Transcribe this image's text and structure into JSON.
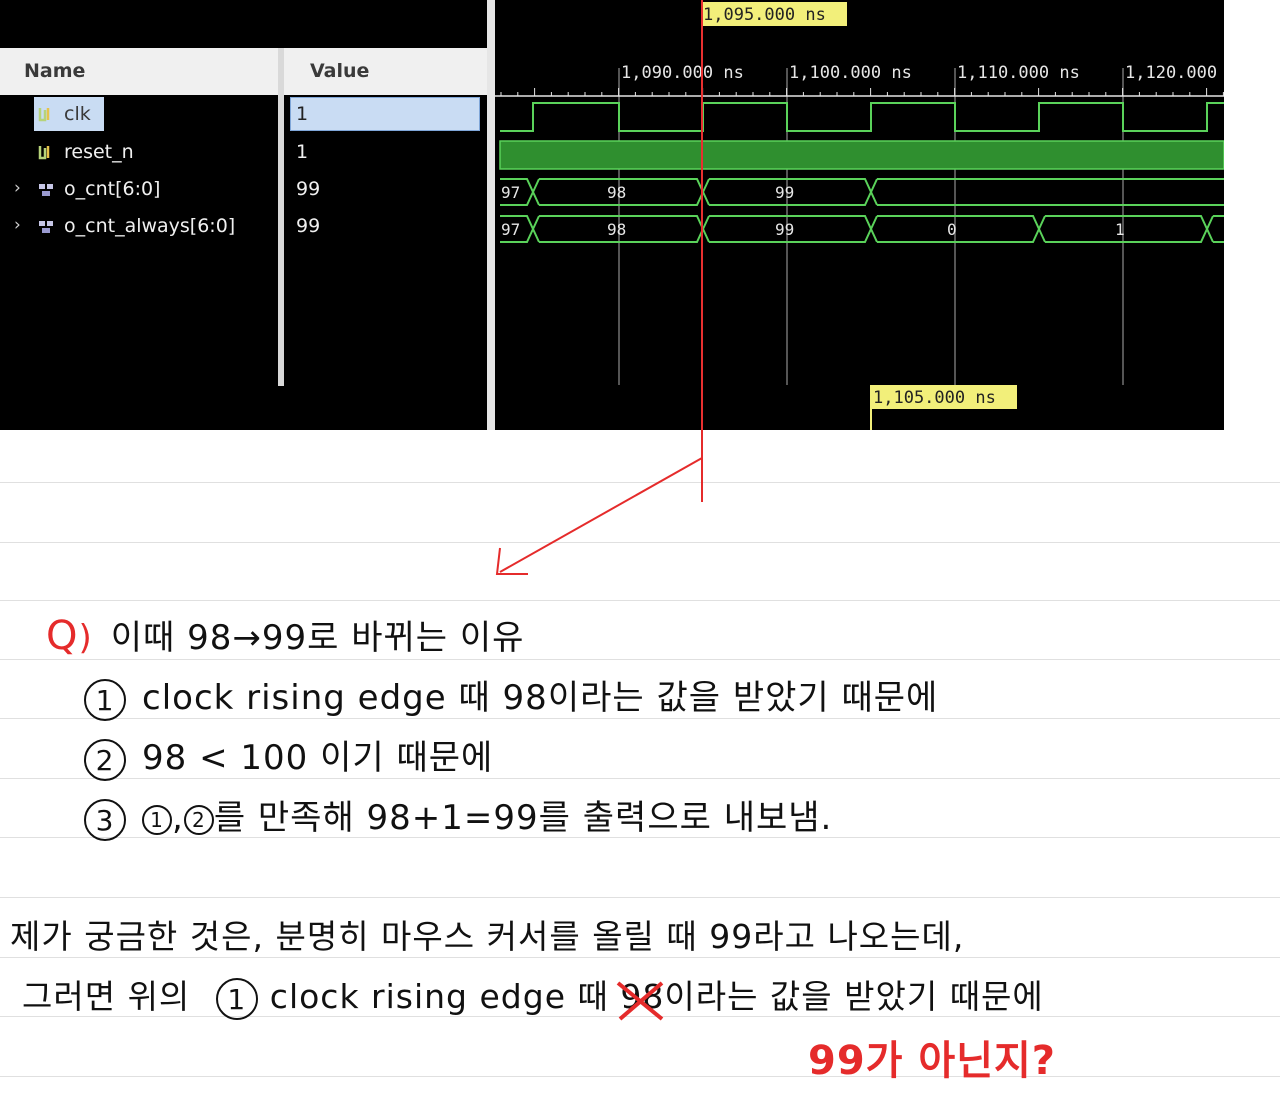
{
  "viewer": {
    "columns": {
      "name": "Name",
      "value": "Value"
    },
    "signals": [
      {
        "name": "clk",
        "value": "1",
        "icon": "clock-signal-icon",
        "expandable": false,
        "selected": true
      },
      {
        "name": "reset_n",
        "value": "1",
        "icon": "wire-signal-icon",
        "expandable": false
      },
      {
        "name": "o_cnt[6:0]",
        "value": "99",
        "icon": "bus-signal-icon",
        "expandable": true
      },
      {
        "name": "o_cnt_always[6:0]",
        "value": "99",
        "icon": "bus-signal-icon",
        "expandable": true
      }
    ],
    "cursor_marker": "1,095.000 ns",
    "second_marker": "1,105.000 ns",
    "time_ticks": [
      "1,090.000 ns",
      "1,100.000 ns",
      "1,110.000 ns",
      "1,120.000 ns"
    ],
    "o_cnt_values": [
      "97",
      "98",
      "99"
    ],
    "o_cnt_always_values": [
      "97",
      "98",
      "99",
      "0",
      "1"
    ],
    "colors": {
      "wave": "#5ad25a",
      "wave_fill": "#2f8f2f",
      "cursor": "#e83030",
      "marker_bg": "#f2ef7a",
      "grid": "#555555"
    }
  },
  "notes": {
    "question_mark": "Q",
    "question_paren": ")",
    "question": "이때 98→99로 바뀌는 이유",
    "reasons": [
      {
        "num": "1",
        "text": "clock rising edge 때 98이라는 값을 받았기 때문에"
      },
      {
        "num": "2",
        "text": "98 < 100 이기 때문에"
      },
      {
        "num": "3",
        "prefix_a": "1",
        "sep": ",",
        "prefix_b": "2",
        "text": "를 만족해 98+1=99를 출력으로 내보냄."
      }
    ],
    "comment_line1": "제가 궁금한 것은, 분명히 마우스 커서를 올릴 때 99라고 나오는데,",
    "comment_line2_a": "그러면 위의",
    "comment_line2_num": "1",
    "comment_line2_b": "clock rising edge 때",
    "comment_struck": "98",
    "comment_line2_c": "이라는 값을 받았기 때문에",
    "comment_red": "99가 아닌지?"
  }
}
